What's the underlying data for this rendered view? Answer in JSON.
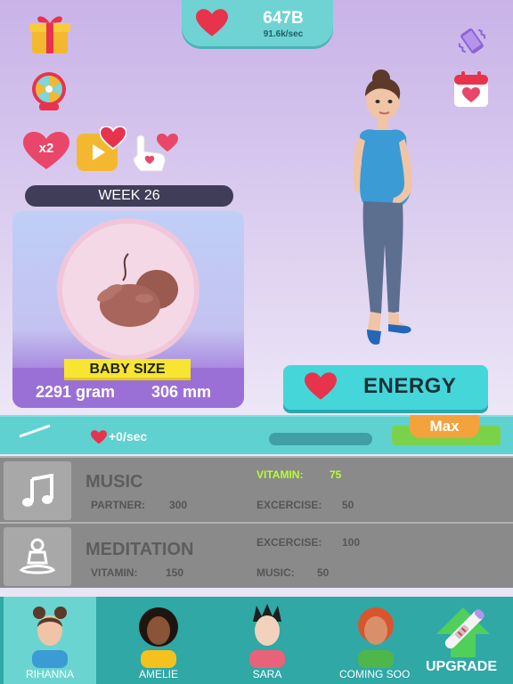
{
  "header": {
    "currency_amount": "647B",
    "currency_rate": "91.6k/sec",
    "currency_icon": "heart-icon"
  },
  "left_icons": [
    {
      "name": "gift-icon"
    },
    {
      "name": "prize-wheel-icon"
    },
    {
      "name": "x2-heart-boost",
      "label": "x2"
    },
    {
      "name": "video-ad-heart-icon"
    },
    {
      "name": "tap-heart-icon"
    }
  ],
  "right_icons": [
    {
      "name": "vibration-toggle-icon"
    },
    {
      "name": "calendar-heart-icon"
    }
  ],
  "week_label": "WEEK 26",
  "baby": {
    "size_label": "BABY SIZE",
    "weight": "2291 gram",
    "length": "306 mm"
  },
  "energy_button": {
    "label": "ENERGY"
  },
  "partial_upgrade": {
    "rate": "+0/sec",
    "max_label": "Max"
  },
  "upgrades": [
    {
      "title": "MUSIC",
      "icon": "music-note-icon",
      "stats": [
        {
          "k": "PARTNER:",
          "v": "300"
        },
        {
          "k": "VITAMIN:",
          "v": "75"
        },
        {
          "k": "EXCERCISE:",
          "v": "50"
        }
      ]
    },
    {
      "title": "MEDITATION",
      "icon": "meditation-icon",
      "stats": [
        {
          "k": "VITAMIN:",
          "v": "150"
        },
        {
          "k": "EXCERCISE:",
          "v": "100"
        },
        {
          "k": "MUSIC:",
          "v": "50"
        }
      ]
    }
  ],
  "tabs": [
    {
      "name": "RIHANNA",
      "active": true
    },
    {
      "name": "AMELIE",
      "active": false
    },
    {
      "name": "SARA",
      "active": false
    },
    {
      "name": "COMING SOON",
      "active": false
    }
  ],
  "upgrade_tab": {
    "label": "UPGRADE"
  },
  "colors": {
    "accent": "#45d6da",
    "heart": "#e8334c",
    "highlight": "#b8ff2e"
  }
}
